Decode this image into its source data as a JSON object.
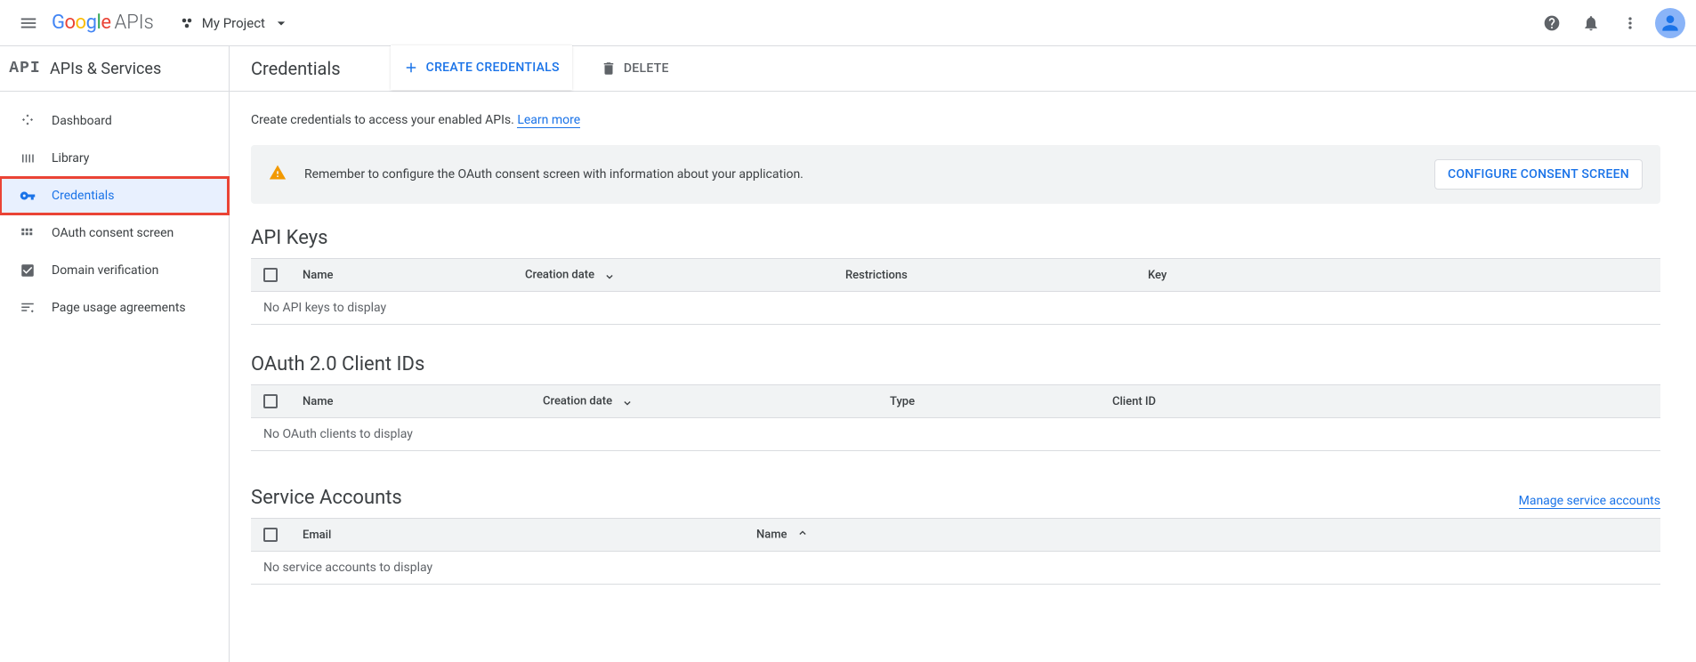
{
  "topbar": {
    "logo_suffix": "APIs",
    "project_name": "My Project"
  },
  "section": {
    "badge": "API",
    "title": "APIs & Services"
  },
  "page": {
    "title": "Credentials",
    "create_btn": "CREATE CREDENTIALS",
    "delete_btn": "DELETE"
  },
  "sidebar": {
    "items": [
      {
        "label": "Dashboard"
      },
      {
        "label": "Library"
      },
      {
        "label": "Credentials"
      },
      {
        "label": "OAuth consent screen"
      },
      {
        "label": "Domain verification"
      },
      {
        "label": "Page usage agreements"
      }
    ]
  },
  "intro": {
    "text": "Create credentials to access your enabled APIs. ",
    "link": "Learn more"
  },
  "alert": {
    "text": "Remember to configure the OAuth consent screen with information about your application.",
    "button": "CONFIGURE CONSENT SCREEN"
  },
  "api_keys": {
    "heading": "API Keys",
    "cols": {
      "name": "Name",
      "creation": "Creation date",
      "restrictions": "Restrictions",
      "key": "Key"
    },
    "empty": "No API keys to display"
  },
  "oauth_clients": {
    "heading": "OAuth 2.0 Client IDs",
    "cols": {
      "name": "Name",
      "creation": "Creation date",
      "type": "Type",
      "client_id": "Client ID"
    },
    "empty": "No OAuth clients to display"
  },
  "service_accounts": {
    "heading": "Service Accounts",
    "manage_link": "Manage service accounts",
    "cols": {
      "email": "Email",
      "name": "Name"
    },
    "empty": "No service accounts to display"
  }
}
